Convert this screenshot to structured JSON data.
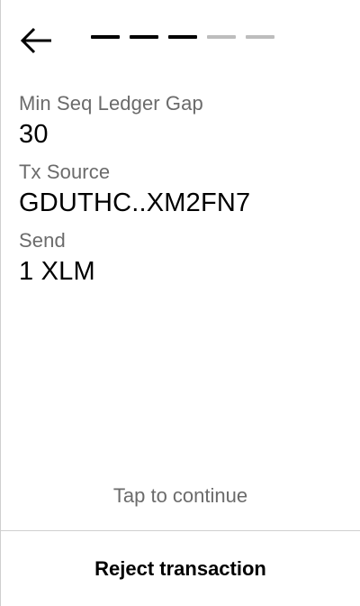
{
  "header": {
    "back_icon": "arrow-left-icon",
    "progress": {
      "total_steps": 5,
      "completed_steps": 3,
      "active_color": "#000000",
      "inactive_color": "#bdbdbd"
    }
  },
  "fields": [
    {
      "label": "Min Seq Ledger Gap",
      "value": "30"
    },
    {
      "label": "Tx Source",
      "value": "GDUTHC..XM2FN7"
    },
    {
      "label": "Send",
      "value": "1 XLM"
    }
  ],
  "footer": {
    "tap_hint": "Tap to continue",
    "reject_label": "Reject transaction"
  }
}
